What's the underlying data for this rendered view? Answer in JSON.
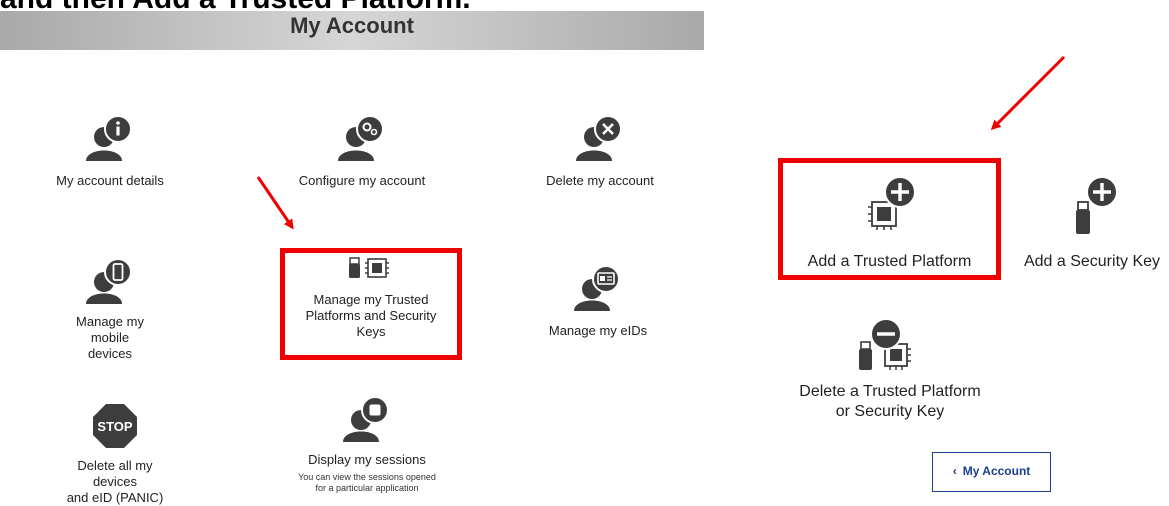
{
  "caption": "and then Add a Trusted Platform.",
  "page_title": "My Account",
  "tiles": {
    "account_details": "My account details",
    "configure": "Configure my account",
    "delete_account": "Delete my account",
    "mobile_line1": "Manage my mobile",
    "mobile_line2": "devices",
    "trusted_line1": "Manage my Trusted",
    "trusted_line2": "Platforms and Security",
    "trusted_line3": "Keys",
    "eids": "Manage my eIDs",
    "panic_line1": "Delete all my devices",
    "panic_line2": "and eID (PANIC)",
    "sessions": "Display my sessions",
    "sessions_note_line1": "You can view the sessions opened",
    "sessions_note_line2": "for a particular application",
    "stop_text": "STOP"
  },
  "right_panel": {
    "add_trusted": "Add a Trusted Platform",
    "add_key": "Add a Security Key",
    "delete_line1": "Delete a Trusted Platform",
    "delete_line2": "or Security Key",
    "back_label": "My Account"
  },
  "colors": {
    "icon": "#3d3d3d",
    "highlight": "#ee0000",
    "link": "#1a3f8f"
  }
}
